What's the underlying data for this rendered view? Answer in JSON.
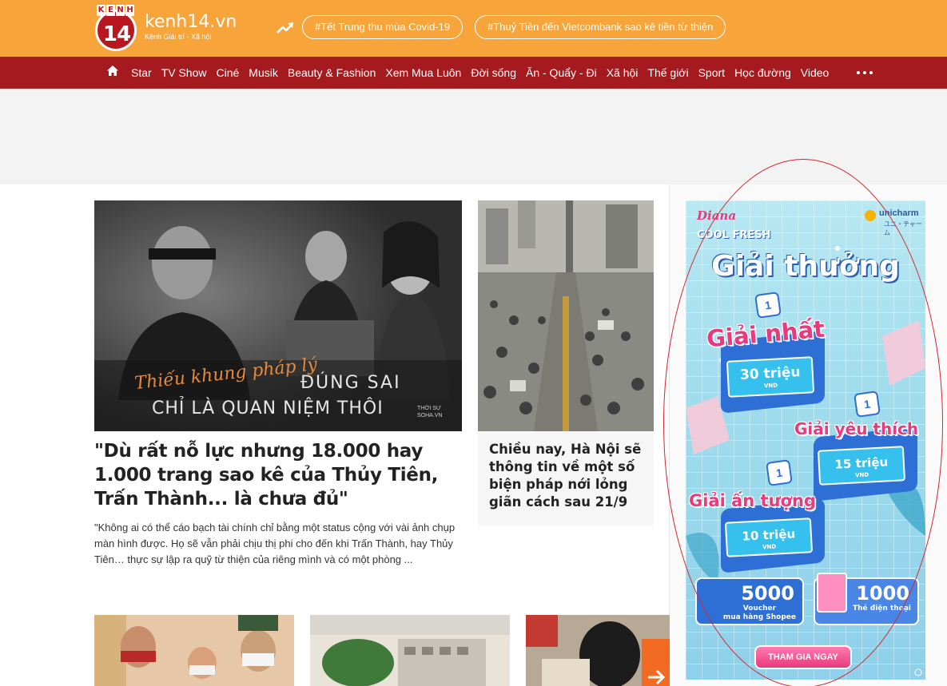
{
  "header": {
    "logo_kenh_letters": [
      "K",
      "E",
      "N",
      "H"
    ],
    "logo_number": "14",
    "domain": "kenh14.vn",
    "tagline": "Kênh Giải trí - Xã hội",
    "trending_tags": [
      "#Tết Trung thu mùa Covid-19",
      "#Thuỷ Tiên đến Vietcombank sao kê tiền từ thiện"
    ],
    "colors": {
      "orange": "#f7a43a",
      "red": "#a41a1e"
    }
  },
  "nav": {
    "items": [
      "Star",
      "TV Show",
      "Ciné",
      "Musik",
      "Beauty & Fashion",
      "Xem Mua Luôn",
      "Đời sống",
      "Ăn - Quẩy - Đi",
      "Xã hội",
      "Thế giới",
      "Sport",
      "Học đường",
      "Video"
    ]
  },
  "hero": {
    "image_caption_script": "Thiếu khung pháp lý",
    "image_caption_line1": "ĐÚNG SAI",
    "image_caption_line2": "CHỈ LÀ QUAN NIỆM THÔI",
    "image_source": "THỜI SỰ\nSOHA.VN",
    "title": "\"Dù rất nỗ lực nhưng 18.000 hay 1.000 trang sao kê của Thủy Tiên, Trấn Thành... là chưa đủ\"",
    "summary": "\"Không ai có thể cáo bạch tài chính chỉ bằng một status cộng với vài ảnh chụp màn hình được. Họ sẽ vẫn phải chịu thị phi cho đến khi Trấn Thành, hay Thủy Tiên… thực sự lập ra quỹ từ thiện của riêng mình và có một phòng ..."
  },
  "side_story": {
    "title": "Chiều nay, Hà Nội sẽ thông tin về một số biện pháp nới lỏng giãn cách sau 21/9"
  },
  "ad": {
    "brand": "Diana",
    "product": "COOL FRESH",
    "maker": "unicharm",
    "maker_sub": "ユニ・チャーム",
    "heading": "Giải thưởng",
    "prizes": [
      {
        "rank": "1",
        "label": "Giải nhất",
        "amount": "30 triệu",
        "unit": "VND"
      },
      {
        "rank": "1",
        "label": "Giải yêu thích",
        "amount": "15 triệu",
        "unit": "VND"
      },
      {
        "rank": "1",
        "label": "Giải ấn tượng",
        "amount": "10 triệu",
        "unit": "VND"
      }
    ],
    "vouchers": [
      {
        "big": "5000",
        "small": "Voucher\nmua hàng Shopee"
      },
      {
        "big": "1000",
        "small": "Thẻ điện thoại"
      }
    ],
    "cta": "THAM GIA NGAY"
  }
}
